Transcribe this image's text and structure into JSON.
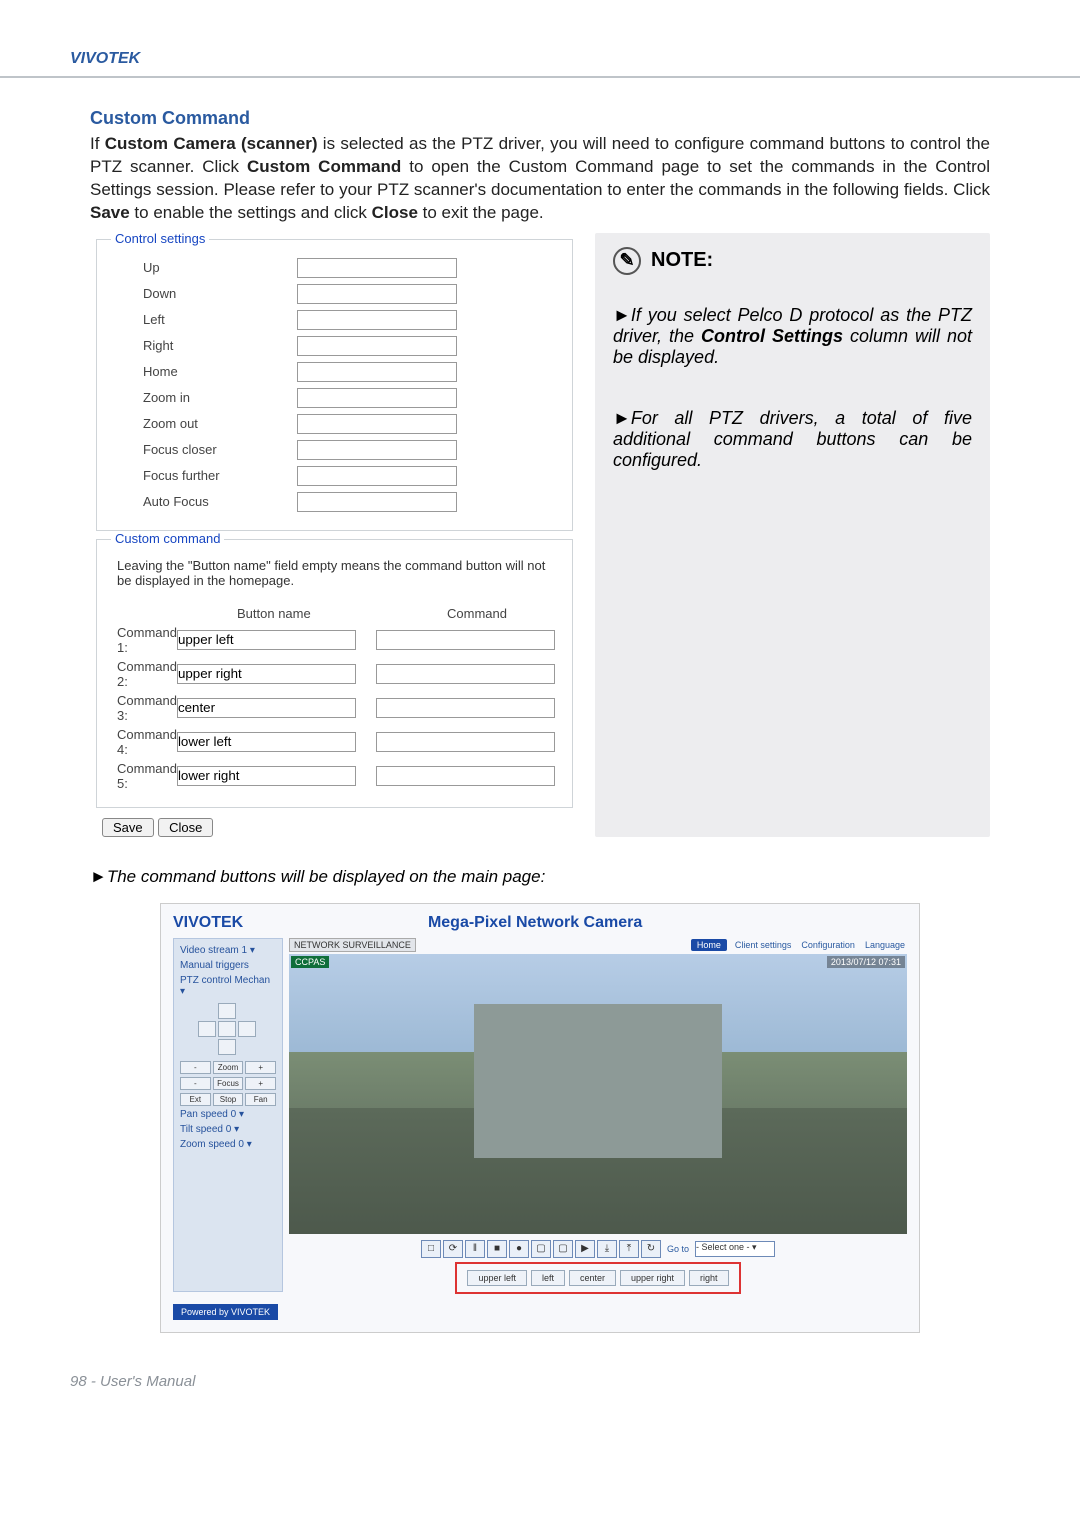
{
  "brand": "VIVOTEK",
  "section_title": "Custom Command",
  "intro": {
    "p1a": "If ",
    "p1b": "Custom Camera (scanner)",
    "p1c": " is selected as the PTZ driver, you will need to configure command buttons to control the PTZ scanner. Click ",
    "p1d": "Custom Command",
    "p1e": " to open the Custom Command page to set the commands in the Control Settings session. Please refer to your PTZ scanner's documentation to enter the commands in the following fields. Click ",
    "p1f": "Save",
    "p1g": " to enable the settings and click ",
    "p1h": "Close",
    "p1i": " to exit the page."
  },
  "control_legend": "Control settings",
  "controls": [
    "Up",
    "Down",
    "Left",
    "Right",
    "Home",
    "Zoom in",
    "Zoom out",
    "Focus closer",
    "Focus further",
    "Auto Focus"
  ],
  "custom_legend": "Custom command",
  "custom_desc": "Leaving the \"Button name\" field empty means the command button will not be displayed in the homepage.",
  "headers": {
    "button_name": "Button name",
    "command": "Command"
  },
  "commands": [
    {
      "label": "Command 1:",
      "name": "upper left",
      "cmd": ""
    },
    {
      "label": "Command 2:",
      "name": "upper right",
      "cmd": ""
    },
    {
      "label": "Command 3:",
      "name": "center",
      "cmd": ""
    },
    {
      "label": "Command 4:",
      "name": "lower left",
      "cmd": ""
    },
    {
      "label": "Command 5:",
      "name": "lower right",
      "cmd": ""
    }
  ],
  "buttons": {
    "save": "Save",
    "close": "Close"
  },
  "note_title": "NOTE:",
  "note1a": "If you select Pelco D protocol as the PTZ driver, the ",
  "note1b": "Control Settings",
  "note1c": " column will not be displayed.",
  "note2": "For all PTZ drivers, a total of five additional command buttons can be configured.",
  "caption": "The command buttons will be displayed on the main page:",
  "liveview": {
    "logo": "VIVOTEK",
    "title": "Mega-Pixel Network Camera",
    "side": {
      "video_stream_label": "Video stream",
      "video_stream_value": "1",
      "manual_triggers": "Manual triggers",
      "ptz_label": "PTZ control",
      "ptz_value": "Mechan",
      "zoom_btns": [
        "-",
        "Zoom",
        "+"
      ],
      "focus_btns": [
        "-",
        "Focus",
        "+"
      ],
      "misc_btns": [
        "Ext",
        "Stop",
        "Fan"
      ],
      "pan": {
        "label": "Pan speed",
        "value": "0"
      },
      "tilt": {
        "label": "Tilt speed",
        "value": "0"
      },
      "zoom": {
        "label": "Zoom speed",
        "value": "0"
      }
    },
    "topbar": {
      "url": "NETWORK SURVEILLANCE",
      "tabs": [
        "Home",
        "Client settings",
        "Configuration",
        "Language"
      ]
    },
    "video": {
      "tag": "CCPAS",
      "ts": "2013/07/12 07:31"
    },
    "icons": [
      "□",
      "⟳",
      "‖",
      "■",
      "●",
      "▢",
      "▢",
      "▶",
      "⤓",
      "⤒",
      "↻"
    ],
    "goto_label": "Go to",
    "goto_value": "- Select one -",
    "cmd_buttons": [
      "upper left",
      "left",
      "center",
      "upper right",
      "right"
    ],
    "powered": "Powered by VIVOTEK"
  },
  "footer": "98 - User's Manual"
}
